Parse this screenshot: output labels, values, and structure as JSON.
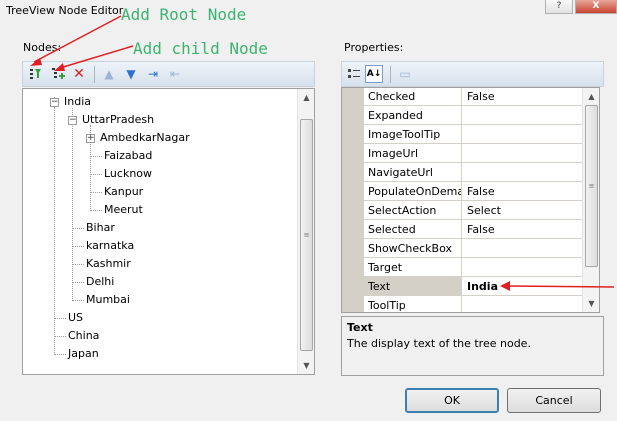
{
  "window": {
    "title": "TreeView Node Editor",
    "help_label": "?",
    "close_label": "X"
  },
  "annotations": {
    "add_root": "Add Root Node",
    "add_child": "Add child Node"
  },
  "nodes_panel": {
    "label": "Nodes:",
    "toolbar": {
      "add_root_icon": "add-root-icon",
      "add_child_icon": "add-child-icon",
      "delete_icon": "delete-icon",
      "move_up_icon": "move-up-icon",
      "move_down_icon": "move-down-icon",
      "indent_icon": "indent-icon",
      "unindent_icon": "unindent-icon"
    },
    "tree": {
      "india": "India",
      "uttarpradesh": "UttarPradesh",
      "ambedkarnagar": "AmbedkarNagar",
      "faizabad": "Faizabad",
      "lucknow": "Lucknow",
      "kanpur": "Kanpur",
      "meerut": "Meerut",
      "bihar": "Bihar",
      "karnatka": "karnatka",
      "kashmir": "Kashmir",
      "delhi": "Delhi",
      "mumbai": "Mumbai",
      "us": "US",
      "china": "China",
      "japan": "Japan"
    },
    "expanded_glyph": "−",
    "collapsed_glyph": "+"
  },
  "properties_panel": {
    "label": "Properties:",
    "toolbar_icons": [
      "categorized-icon",
      "alphabetical-icon",
      "property-pages-icon"
    ],
    "rows": [
      {
        "name": "Checked",
        "value": "False"
      },
      {
        "name": "Expanded",
        "value": ""
      },
      {
        "name": "ImageToolTip",
        "value": ""
      },
      {
        "name": "ImageUrl",
        "value": ""
      },
      {
        "name": "NavigateUrl",
        "value": ""
      },
      {
        "name": "PopulateOnDema",
        "value": "False"
      },
      {
        "name": "SelectAction",
        "value": "Select"
      },
      {
        "name": "Selected",
        "value": "False"
      },
      {
        "name": "ShowCheckBox",
        "value": ""
      },
      {
        "name": "Target",
        "value": ""
      },
      {
        "name": "Text",
        "value": "India"
      },
      {
        "name": "ToolTip",
        "value": ""
      }
    ],
    "selected_row": "Text",
    "description": {
      "title": "Text",
      "body": "The display text of the tree node."
    }
  },
  "buttons": {
    "ok": "OK",
    "cancel": "Cancel"
  },
  "colors": {
    "annotation_text": "#3cb371",
    "annotation_arrow": "#e02020",
    "toolbar_bg": "#dfe7f0"
  }
}
